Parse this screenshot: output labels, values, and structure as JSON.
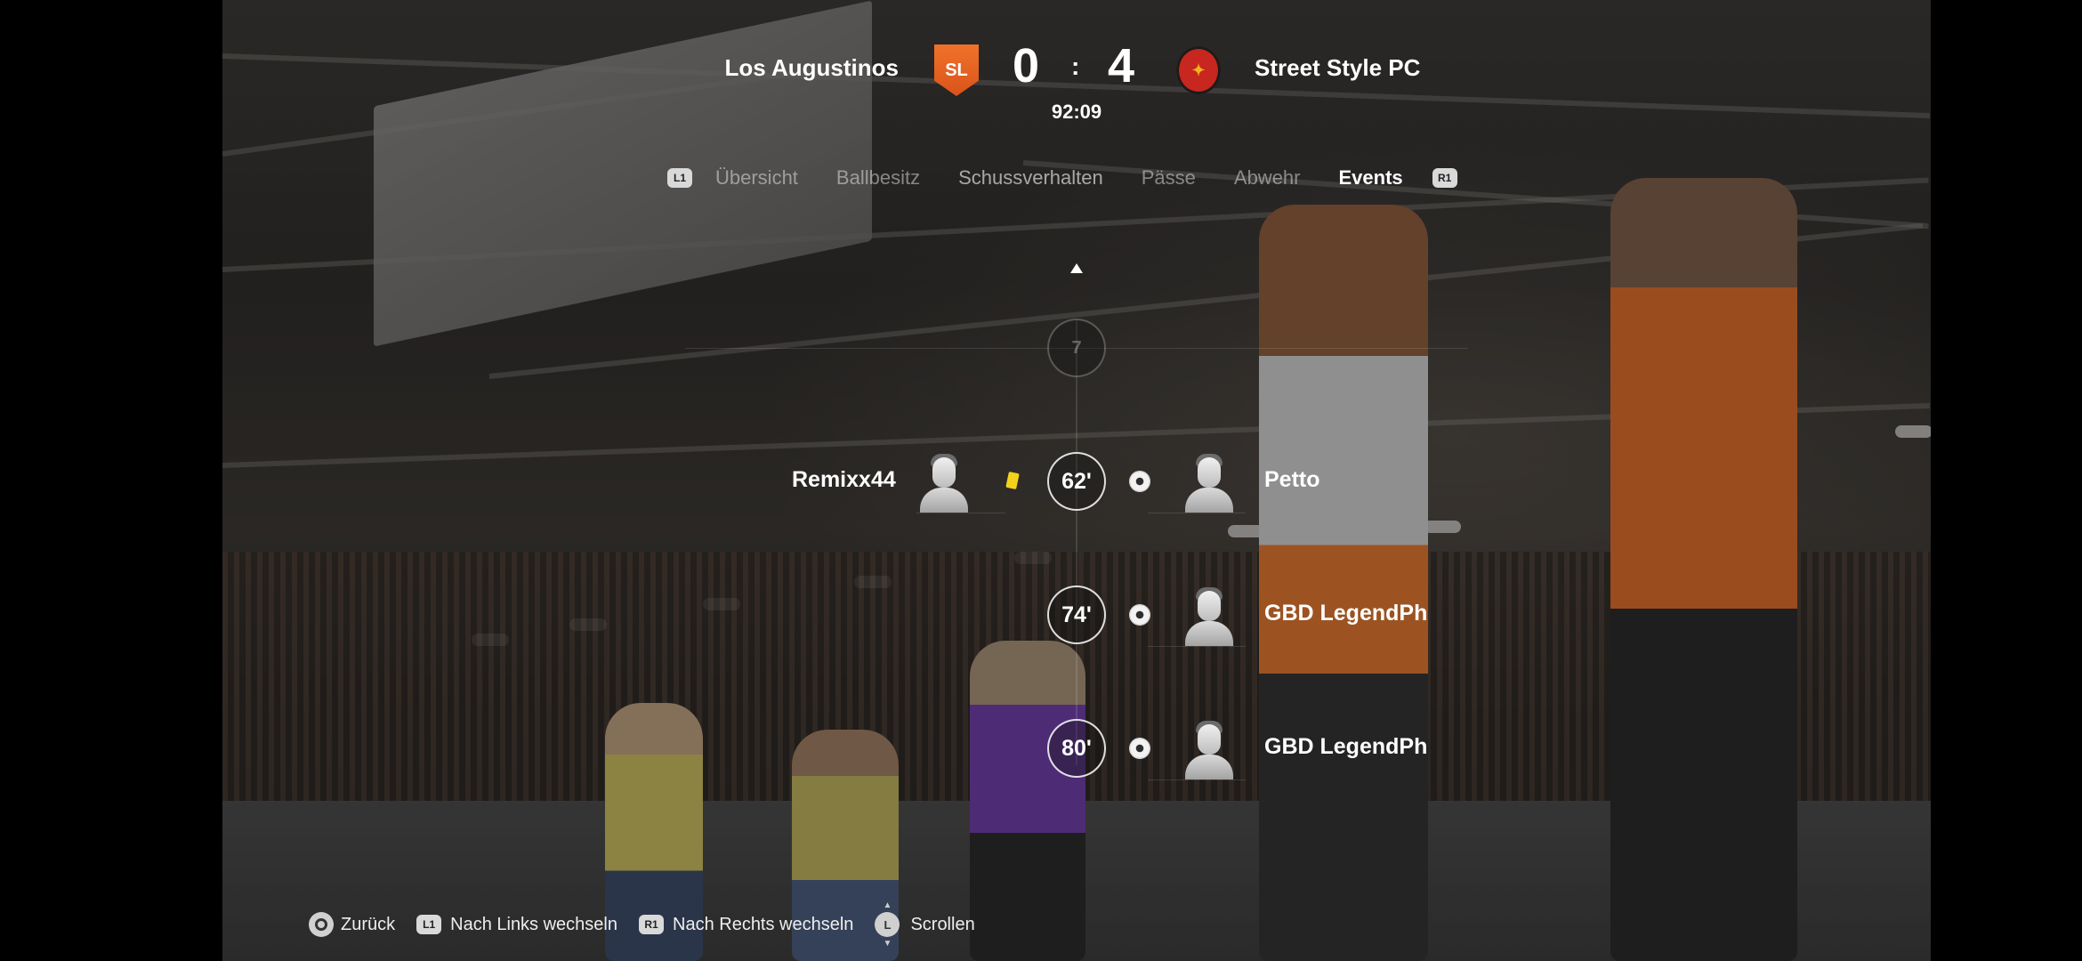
{
  "match": {
    "home_team": "Los Augustinos",
    "away_team": "Street Style PC",
    "home_score": "0",
    "separator": ":",
    "away_score": "4",
    "clock": "92:09",
    "home_crest_text": "SL",
    "away_crest_text": "✦"
  },
  "tabs": [
    {
      "label": "Übersicht"
    },
    {
      "label": "Ballbesitz"
    },
    {
      "label": "Schussverhalten"
    },
    {
      "label": "Pässe"
    },
    {
      "label": "Abwehr"
    },
    {
      "label": "Events"
    }
  ],
  "tab_buttons": {
    "left": "L1",
    "right": "R1"
  },
  "events": [
    {
      "minute": "7",
      "faded": true
    },
    {
      "minute": "62'",
      "home_player": "Remixx44",
      "home_event": "yellow-card",
      "away_player": "Petto",
      "away_event": "goal"
    },
    {
      "minute": "74'",
      "away_player": "GBD LegendPh",
      "away_event": "goal"
    },
    {
      "minute": "80'",
      "away_player": "GBD LegendPh",
      "away_event": "goal"
    }
  ],
  "controls": {
    "back_label": "Zurück",
    "left_button": "L1",
    "left_label": "Nach Links wechseln",
    "right_button": "R1",
    "right_label": "Nach Rechts wechseln",
    "scroll_button": "L",
    "scroll_label": "Scrollen"
  }
}
